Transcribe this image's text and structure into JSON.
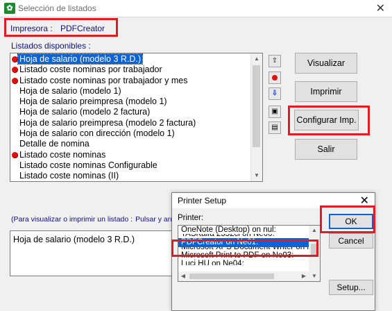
{
  "window": {
    "title": "Selección de listados",
    "app_icon": "app-icon",
    "close_symbol": "✕"
  },
  "printer": {
    "label": "Impresora :",
    "value": "PDFCreator"
  },
  "list": {
    "label": "Listados disponibles :",
    "items": [
      {
        "text": "Hoja de salario (modelo 3 R.D.)",
        "marked": true,
        "selected": true
      },
      {
        "text": "Listado coste nominas por trabajador",
        "marked": true
      },
      {
        "text": "Listado coste nominas por trabajador y mes",
        "marked": true
      },
      {
        "text": "Hoja de salario (modelo 1)",
        "marked": false
      },
      {
        "text": "Hoja de salario preimpresa (modelo 1)",
        "marked": false
      },
      {
        "text": "Hoja de salario (modelo 2 factura)",
        "marked": false
      },
      {
        "text": "Hoja de salario preimpresa (modelo 2 factura)",
        "marked": false
      },
      {
        "text": "Hoja de salario con dirección (modelo 1)",
        "marked": false
      },
      {
        "text": "Detalle de nomina",
        "marked": false
      },
      {
        "text": "Listado coste nominas",
        "marked": true
      },
      {
        "text": "Listado coste nominas Configurable",
        "marked": false
      },
      {
        "text": "Listado coste nominas (II)",
        "marked": false
      }
    ]
  },
  "tools": {
    "up": "⇧",
    "mark": "mark-icon",
    "down": "⇩",
    "save": "save-icon",
    "properties": "properties-icon"
  },
  "buttons": {
    "visualizar": "Visualizar",
    "imprimir": "Imprimir",
    "configurar": "Configurar Imp.",
    "salir": "Salir"
  },
  "hint": {
    "part1": "(Para visualizar o imprimir un listado :",
    "part2": "Pulsar y arr"
  },
  "description": "Hoja de salario (modelo 3 R.D.)",
  "printer_setup": {
    "title": "Printer Setup",
    "close_symbol": "✕",
    "printer_label": "Printer:",
    "printers": [
      "OneNote (Desktop) on nul:",
      "TASKalfa 2552ci on Ne00:",
      "PDFCreator on Ne01:",
      "Microsoft XPS Document Writer on Ne02:",
      "Microsoft Print to PDF on Ne03:",
      "Luci HU on Ne04:"
    ],
    "ok": "OK",
    "cancel": "Cancel",
    "setup": "Setup..."
  },
  "colors": {
    "highlight": "#e01b24",
    "selection": "#0a64d8",
    "label_text": "#10107a",
    "marker": "#e01010"
  }
}
